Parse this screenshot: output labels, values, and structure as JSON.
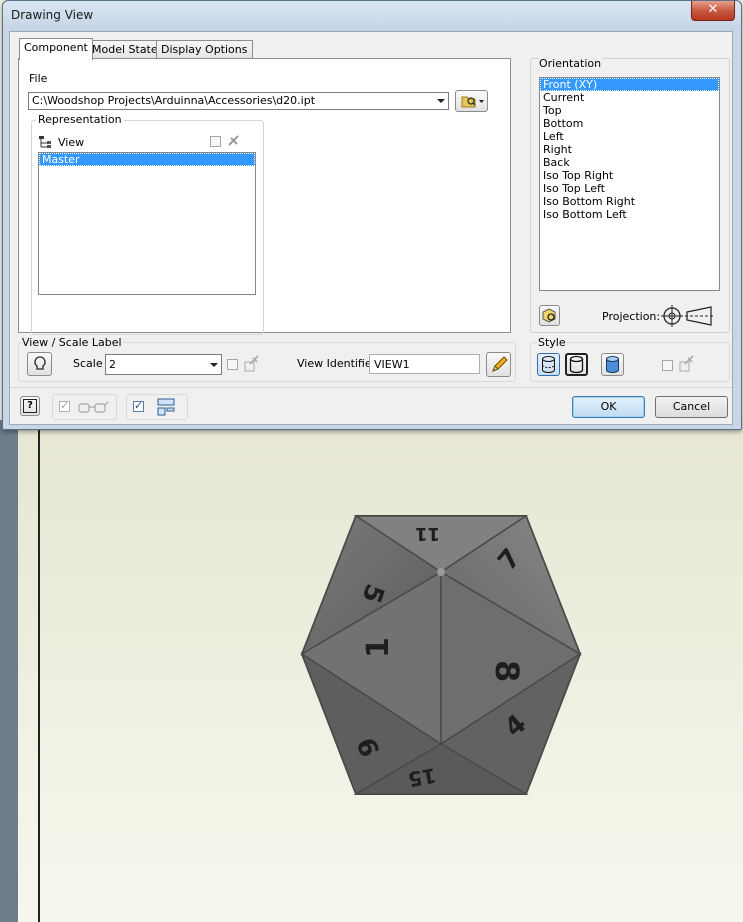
{
  "window": {
    "title": "Drawing View",
    "close_symbol": "✕"
  },
  "tabs": [
    {
      "label": "Component",
      "active": true
    },
    {
      "label": "Model State",
      "active": false
    },
    {
      "label": "Display Options",
      "active": false
    }
  ],
  "file": {
    "label": "File",
    "path": "C:\\Woodshop Projects\\Arduinna\\Accessories\\d20.ipt"
  },
  "representation": {
    "label": "Representation",
    "view_label": "View",
    "items": [
      {
        "label": "Master",
        "selected": true
      }
    ]
  },
  "orientation": {
    "label": "Orientation",
    "items": [
      {
        "label": "Front (XY)",
        "selected": true
      },
      {
        "label": "Current",
        "selected": false
      },
      {
        "label": "Top",
        "selected": false
      },
      {
        "label": "Bottom",
        "selected": false
      },
      {
        "label": "Left",
        "selected": false
      },
      {
        "label": "Right",
        "selected": false
      },
      {
        "label": "Back",
        "selected": false
      },
      {
        "label": "Iso Top Right",
        "selected": false
      },
      {
        "label": "Iso Top Left",
        "selected": false
      },
      {
        "label": "Iso Bottom Right",
        "selected": false
      },
      {
        "label": "Iso Bottom Left",
        "selected": false
      }
    ],
    "projection_label": "Projection:"
  },
  "view_scale": {
    "label": "View / Scale Label",
    "scale_label": "Scale",
    "scale_value": "2",
    "identifier_label": "View Identifier",
    "identifier_value": "VIEW1"
  },
  "style": {
    "label": "Style"
  },
  "buttons": {
    "ok": "OK",
    "cancel": "Cancel",
    "help": "?"
  },
  "die_faces": [
    "5",
    "7",
    "1",
    "8",
    "6",
    "4",
    "15",
    "11"
  ],
  "colors": {
    "selection": "#3399ff",
    "titlebar": "#c4d3e5",
    "close": "#c85a43",
    "sheet": "#eeeedd",
    "die": "#6f6f6f"
  }
}
